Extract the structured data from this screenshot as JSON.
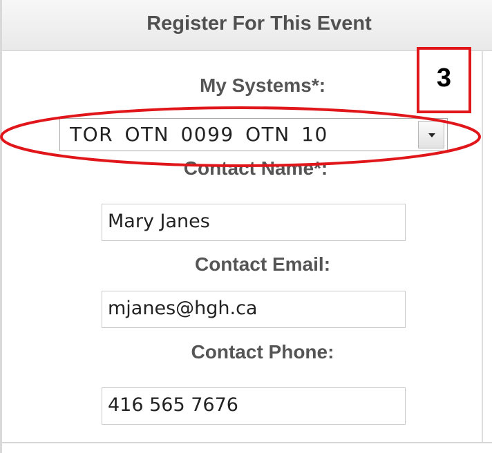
{
  "panel": {
    "title": "Register For This Event"
  },
  "form": {
    "systems_label": "My Systems*:",
    "systems_value": "TOR OTN 0099 OTN 10",
    "contact_name_label": "Contact Name*:",
    "contact_name_value": "Mary Janes",
    "contact_email_label": "Contact Email:",
    "contact_email_value": "mjanes@hgh.ca",
    "contact_phone_label": "Contact Phone:",
    "contact_phone_value": "416 565 7676"
  },
  "annotation": {
    "step_number": "3",
    "color": "#e0161b"
  },
  "icons": {
    "dropdown": "chevron-down-icon"
  }
}
